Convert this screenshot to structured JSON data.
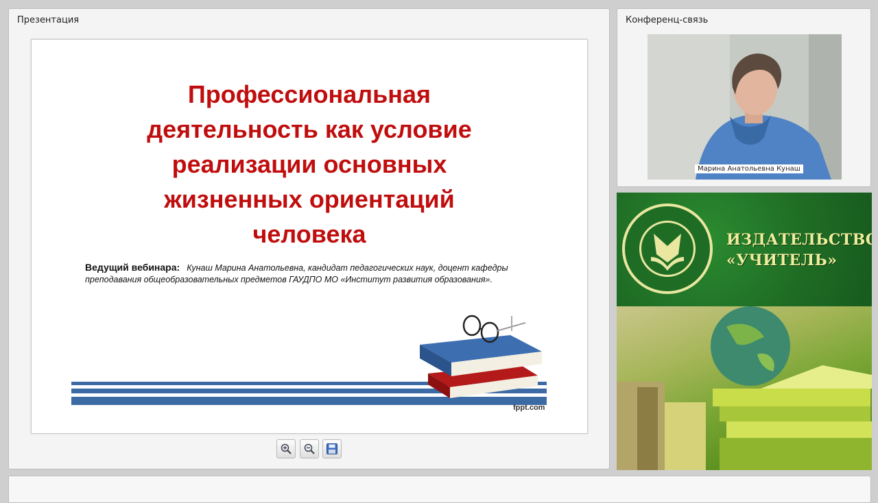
{
  "presentation": {
    "panel_title": "Презентация",
    "slide": {
      "title_lines": [
        "Профессиональная",
        "деятельность как условие",
        "реализации основных",
        "жизненных ориентаций",
        "человека"
      ],
      "presenter_label": "Ведущий вебинара:",
      "presenter_text": "Кунаш Марина Анатольевна, кандидат педагогических наук, доцент кафедры преподавания общеобразовательных предметов ГАУДПО МО «Институт развития образования».",
      "footer_brand": "fppt.com"
    },
    "toolbar": {
      "zoom_in_icon": "zoom-in-icon",
      "zoom_out_icon": "zoom-out-icon",
      "save_icon": "save-icon"
    }
  },
  "conference": {
    "panel_title": "Конференц-связь",
    "participant_name": "Марина Анатольевна Кунаш"
  },
  "banner": {
    "line1": "ИЗДАТЕЛЬСТВО",
    "line2": "«УЧИТЕЛЬ»"
  },
  "colors": {
    "slide_title": "#c00d0d",
    "stripe": "#3b6aa5",
    "banner_green": "#1f6d25",
    "banner_text": "#f0ee9d"
  }
}
